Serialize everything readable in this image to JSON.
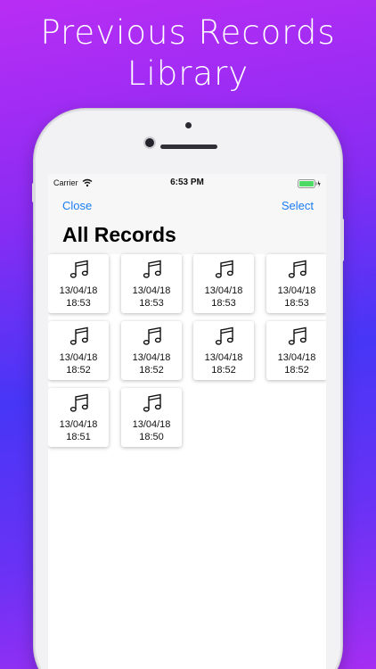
{
  "headline": {
    "line1": "Previous Records",
    "line2": "Library"
  },
  "status_bar": {
    "carrier": "Carrier",
    "time": "6:53 PM"
  },
  "nav": {
    "close_label": "Close",
    "select_label": "Select",
    "title": "All Records"
  },
  "records": [
    {
      "date": "13/04/18",
      "time": "18:53"
    },
    {
      "date": "13/04/18",
      "time": "18:53"
    },
    {
      "date": "13/04/18",
      "time": "18:53"
    },
    {
      "date": "13/04/18",
      "time": "18:53"
    },
    {
      "date": "13/04/18",
      "time": "18:52"
    },
    {
      "date": "13/04/18",
      "time": "18:52"
    },
    {
      "date": "13/04/18",
      "time": "18:52"
    },
    {
      "date": "13/04/18",
      "time": "18:52"
    },
    {
      "date": "13/04/18",
      "time": "18:51"
    },
    {
      "date": "13/04/18",
      "time": "18:50"
    }
  ],
  "colors": {
    "accent": "#1a7cf4",
    "battery": "#4cd964"
  },
  "icons": {
    "record": "music-note-icon",
    "wifi": "wifi-icon",
    "battery": "battery-icon"
  }
}
